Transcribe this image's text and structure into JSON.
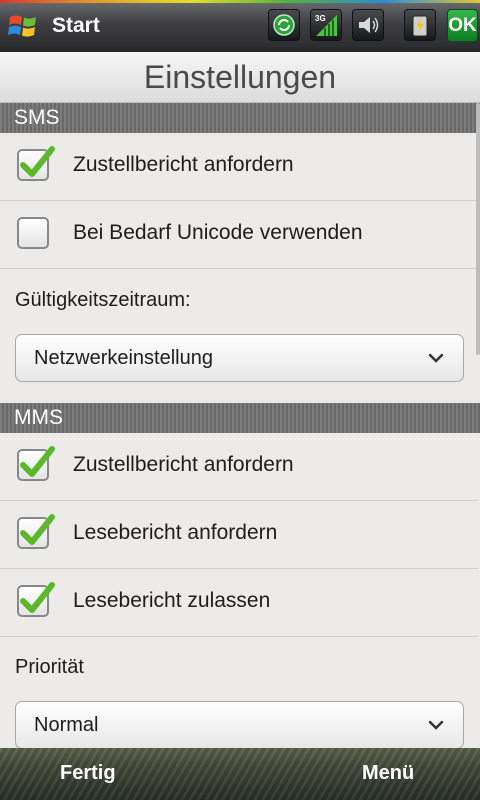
{
  "status_bar": {
    "start_label": "Start",
    "icons": [
      "sync-icon",
      "signal-3g-icon",
      "speaker-icon",
      "battery-charging-icon"
    ],
    "ok_label": "OK"
  },
  "title": "Einstellungen",
  "sms": {
    "header": "SMS",
    "delivery_report": {
      "label": "Zustellbericht anfordern",
      "checked": true
    },
    "unicode": {
      "label": "Bei Bedarf Unicode verwenden",
      "checked": false
    },
    "validity_label": "Gültigkeitszeitraum:",
    "validity_value": "Netzwerkeinstellung"
  },
  "mms": {
    "header": "MMS",
    "delivery_report": {
      "label": "Zustellbericht anfordern",
      "checked": true
    },
    "read_report_request": {
      "label": "Lesebericht anfordern",
      "checked": true
    },
    "read_report_allow": {
      "label": "Lesebericht zulassen",
      "checked": true
    },
    "priority_label": "Priorität",
    "priority_value": "Normal"
  },
  "softkeys": {
    "left": "Fertig",
    "right": "Menü"
  },
  "colors": {
    "checkmark": "#5cb82a",
    "ok_button": "#1e9b33"
  }
}
